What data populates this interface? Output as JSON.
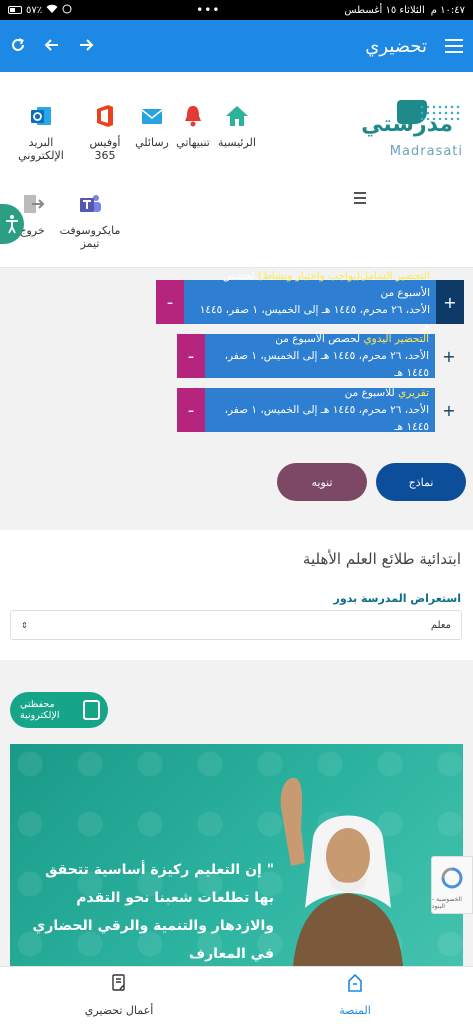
{
  "status_bar": {
    "time": "١٠:٤٧ م",
    "date": "الثلاثاء ١٥ أغسطس",
    "battery": "٥٧٪",
    "dots": "•••"
  },
  "app_bar": {
    "title": "تحضيري"
  },
  "logo": {
    "ar": "مدرستي",
    "en": "Madrasati"
  },
  "nav": [
    {
      "label": "الرئيسية",
      "icon": "home-icon",
      "color": "#2bb39a"
    },
    {
      "label": "تنبيهاتي",
      "icon": "bell-icon",
      "color": "#e53935"
    },
    {
      "label": "رسائلي",
      "icon": "mail-icon",
      "color": "#29a3e0"
    },
    {
      "label": "أوفيس 365",
      "icon": "office-icon",
      "color": "#e8431e"
    },
    {
      "label": "البريد الإلكتروني",
      "icon": "outlook-icon",
      "color": "#0f6cbd"
    },
    {
      "label": "مايكروسوفت تيمز",
      "icon": "teams-icon",
      "color": "#5558af"
    },
    {
      "label": "خروج",
      "icon": "logout-icon",
      "color": "#888888"
    }
  ],
  "prep": [
    {
      "title": "التحضير الشامل(بواجب واختبار ونشاط)",
      "suffix": " لحصص الأسبوع من",
      "range": "الأحد، ٢٦ محرم، ١٤٤٥ هـ إلى الخميس، ١ صفر، ١٤٤٥ هـ"
    },
    {
      "title": "التحضير اليدوي",
      "suffix": " لحصص الأسبوع من",
      "range": "الأحد، ٢٦ محرم، ١٤٤٥ هـ إلى الخميس، ١ صفر، ١٤٤٥ هـ"
    },
    {
      "title": "تقريري",
      "suffix": " للأسبوع من",
      "range": "الأحد، ٢٦ محرم، ١٤٤٥ هـ إلى الخميس، ١ صفر، ١٤٤٥ هـ"
    }
  ],
  "buttons": {
    "plus": "+",
    "minus": "-",
    "samples": "نماذج",
    "notice": "تنويه"
  },
  "school": {
    "name": "ابتدائية طلائع العلم الأهلية",
    "role_label": "استعراض المدرسة بدور",
    "role_value": "معلم"
  },
  "portfolio": {
    "label": "محفظتي الإلكترونية"
  },
  "banner": {
    "quote": "\" إن التعليم ركيزة أساسية تتحقق بها تطلعات شعبنا نحو التقدم والازدهار والتنمية والرقي الحضاري في المعارف"
  },
  "recaptcha": {
    "label": "الخصوصية - البنود"
  },
  "bottom_nav": {
    "platform": "المنصة",
    "my_prep": "أعمال تحضيري"
  },
  "colors": {
    "primary": "#1e88e5",
    "dark_blue": "#0d3a66",
    "magenta": "#b5247d",
    "teal": "#17a58a"
  }
}
